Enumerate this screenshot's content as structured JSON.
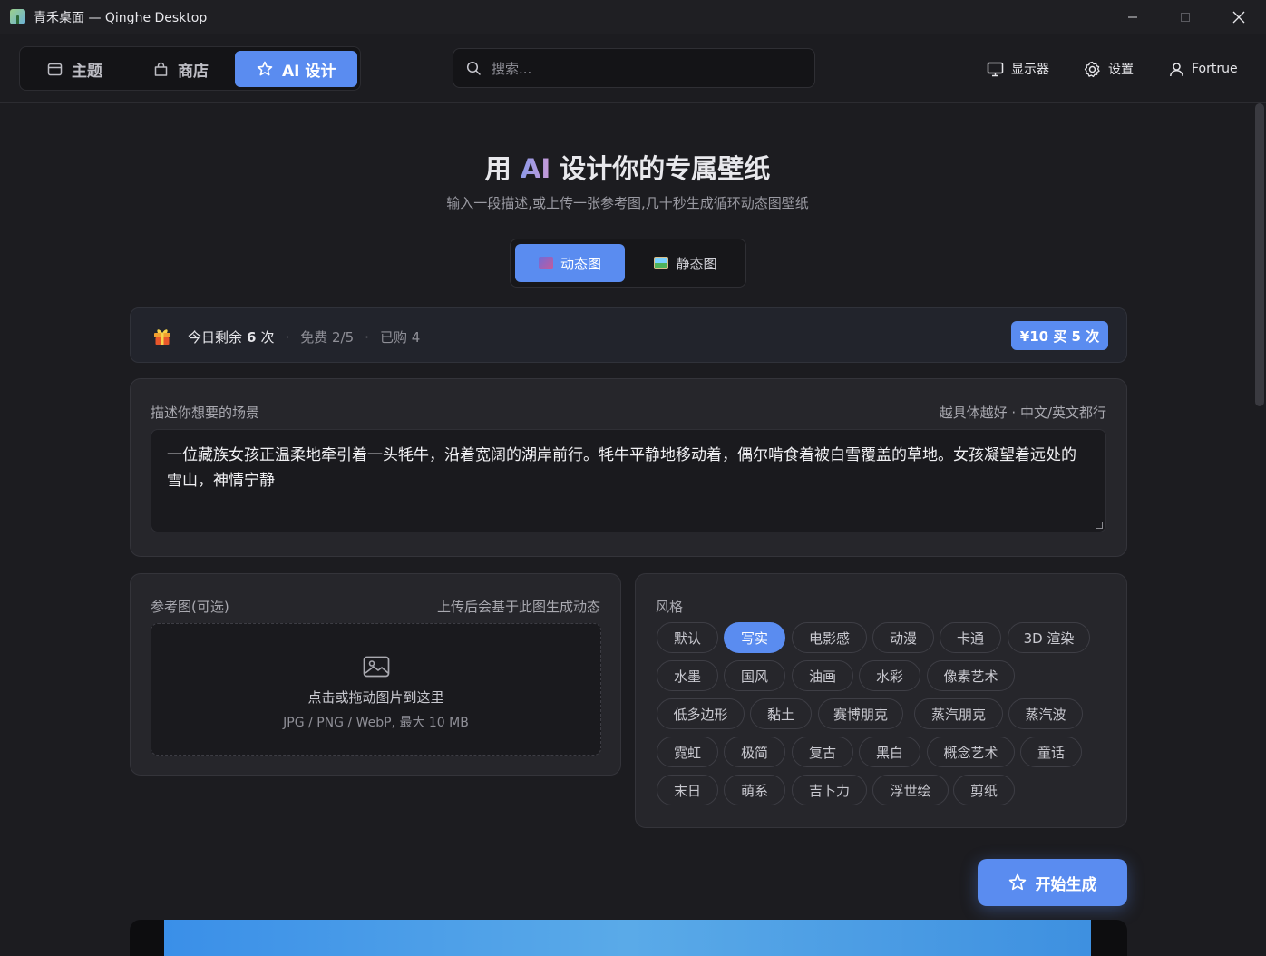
{
  "window": {
    "title": "青禾桌面 — Qinghe Desktop"
  },
  "nav": {
    "tabs": [
      {
        "label": "主题",
        "icon": "window-icon"
      },
      {
        "label": "商店",
        "icon": "bag-icon"
      },
      {
        "label": "AI 设计",
        "icon": "star-icon",
        "active": true
      }
    ]
  },
  "search": {
    "placeholder": "搜索..."
  },
  "header_actions": {
    "display_label": "显示器",
    "settings_label": "设置",
    "user_label": "Fortrue"
  },
  "hero": {
    "title_pre": "用 ",
    "title_ai": "AI",
    "title_post": " 设计你的专属壁纸",
    "subtitle": "输入一段描述,或上传一张参考图,几十秒生成循环动态图壁纸"
  },
  "modes": {
    "animated": "动态图",
    "static": "静态图",
    "selected": "动态图"
  },
  "quota": {
    "remaining_prefix": "今日剩余",
    "remaining_count": "6",
    "remaining_suffix": "次",
    "free": "免费 2/5",
    "purchased": "已购 4",
    "buy_label": "¥10 买 5 次"
  },
  "description": {
    "label": "描述你想要的场景",
    "hint": "越具体越好 · 中文/英文都行",
    "value": "一位藏族女孩正温柔地牵引着一头牦牛，沿着宽阔的湖岸前行。牦牛平静地移动着，偶尔啃食着被白雪覆盖的草地。女孩凝望着远处的雪山，神情宁静"
  },
  "reference": {
    "label": "参考图(可选)",
    "hint": "上传后会基于此图生成动态",
    "drop_main": "点击或拖动图片到这里",
    "drop_sub": "JPG / PNG / WebP, 最大 10 MB"
  },
  "styles": {
    "label": "风格",
    "selected": "写实",
    "items": [
      "默认",
      "写实",
      "电影感",
      "动漫",
      "卡通",
      "3D 渲染",
      "水墨",
      "国风",
      "油画",
      "水彩",
      "像素艺术",
      "低多边形",
      "黏土",
      "赛博朋克",
      "蒸汽朋克",
      "蒸汽波",
      "霓虹",
      "极简",
      "复古",
      "黑白",
      "概念艺术",
      "童话",
      "末日",
      "萌系",
      "吉卜力",
      "浮世绘",
      "剪纸"
    ]
  },
  "generate": {
    "label": "开始生成"
  },
  "colors": {
    "accent": "#5a8cf0",
    "background": "#1c1c20",
    "card": "#26262b"
  }
}
